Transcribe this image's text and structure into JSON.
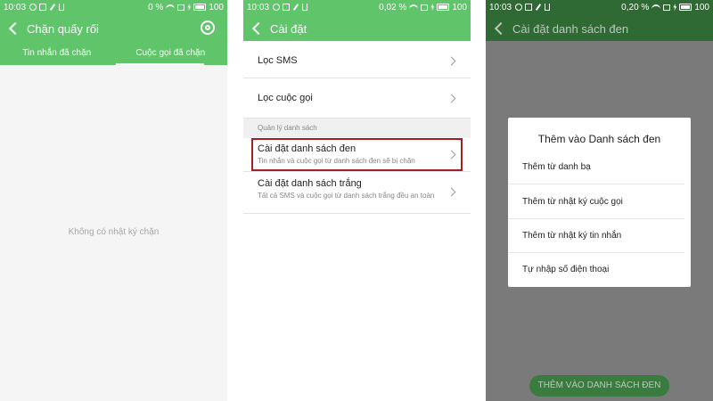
{
  "screen1": {
    "status": {
      "time": "10:03",
      "signal": "0 %",
      "battery": "100"
    },
    "title": "Chặn quấy rối",
    "tabs": [
      "Tin nhắn đã chặn",
      "Cuộc gọi đã chặn"
    ],
    "active_tab": 1,
    "empty_text": "Không có nhật ký chặn"
  },
  "screen2": {
    "status": {
      "time": "10:03",
      "signal": "0,02 %",
      "battery": "100"
    },
    "title": "Cài đặt",
    "items": [
      {
        "label": "Lọc SMS"
      },
      {
        "label": "Lọc cuộc gọi"
      }
    ],
    "section_label": "Quản lý danh sách",
    "list_items": [
      {
        "label": "Cài đặt danh sách đen",
        "sub": "Tin nhắn và cuộc gọi từ danh sách đen sẽ bị chặn"
      },
      {
        "label": "Cài đặt danh sách trắng",
        "sub": "Tất cả SMS và cuộc gọi từ danh sách trắng đều an toàn"
      }
    ],
    "highlight_color": "#a32024"
  },
  "screen3": {
    "status": {
      "time": "10:03",
      "signal": "0,20 %",
      "battery": "100"
    },
    "title": "Cài đặt danh sách đen",
    "dialog": {
      "title": "Thêm vào Danh sách đen",
      "options": [
        "Thêm từ danh bạ",
        "Thêm từ nhật ký cuộc gọi",
        "Thêm từ nhật ký tin nhắn",
        "Tự nhập số điện thoại"
      ]
    },
    "bottom_button": "THÊM VÀO DANH SÁCH ĐEN"
  },
  "colors": {
    "accent_green": "#5fc46a",
    "dim_green": "#2f6a35",
    "overlay": "#7a7a7a"
  }
}
